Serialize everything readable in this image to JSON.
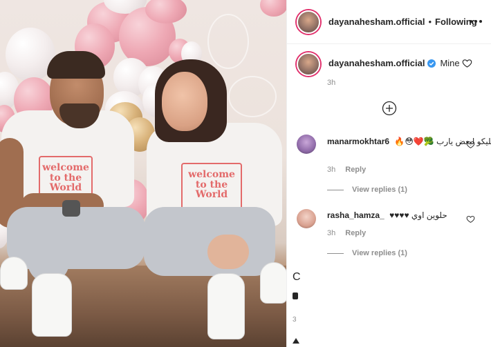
{
  "post": {
    "author": "dayanahesham.official",
    "follow_status": "Following",
    "separator": "•",
    "caption": {
      "username": "dayanahesham.official",
      "text": "Mine",
      "time": "3h"
    },
    "photo_print": "welcome to the World"
  },
  "comments": [
    {
      "username": "manarmokhtar6",
      "text": "ربنا يخليكو لبعض يارب 🥦❤️😳🔥",
      "time": "3h",
      "reply_label": "Reply",
      "view_replies": "View replies (1)"
    },
    {
      "username": "rasha_hamza_",
      "text": "حلوين اوي ♥♥♥♥",
      "time": "3h",
      "reply_label": "Reply",
      "view_replies": "View replies (1)"
    }
  ],
  "clipped": {
    "c_glyph": "C",
    "number": "3"
  },
  "colors": {
    "story_ring": "#e1306c",
    "verified": "#3897f0",
    "secondary_text": "#8e8e8e",
    "primary_text": "#262626"
  },
  "icons": [
    "more-options-icon",
    "verified-badge-icon",
    "heart-icon",
    "plus-circle-icon"
  ]
}
